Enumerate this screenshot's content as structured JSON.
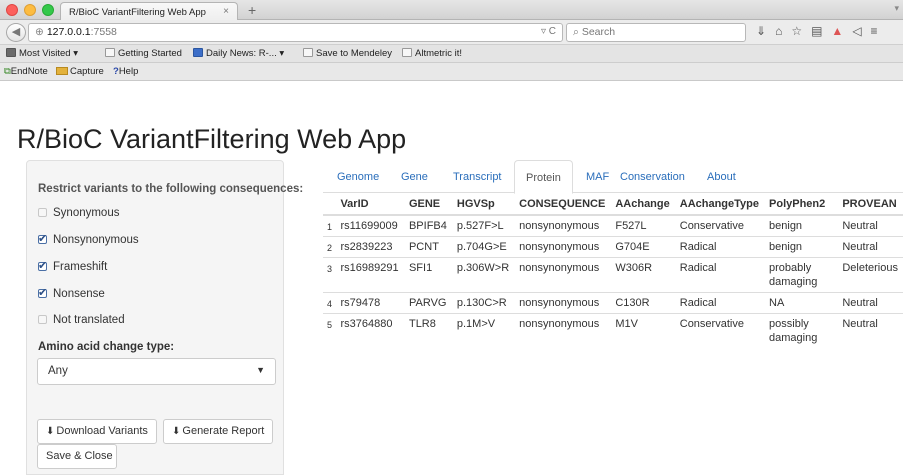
{
  "browser": {
    "tab_title": "R/BioC VariantFiltering Web App",
    "tab_close": "×",
    "new_tab": "+",
    "url_host": "127.0.0.1",
    "url_port": ":7558",
    "search_placeholder": "Search",
    "bookmarks": [
      "Most Visited ▾",
      "Getting Started",
      "Daily News: R-... ▾",
      "Save to Mendeley",
      "Altmetric it!"
    ],
    "addons": [
      "EndNote",
      "Capture",
      "Help"
    ]
  },
  "app": {
    "title": "R/BioC VariantFiltering Web App"
  },
  "sidebar": {
    "heading": "Restrict variants to the following consequences:",
    "consequences": [
      {
        "label": "Synonymous",
        "checked": false
      },
      {
        "label": "Nonsynonymous",
        "checked": true
      },
      {
        "label": "Frameshift",
        "checked": true
      },
      {
        "label": "Nonsense",
        "checked": true
      },
      {
        "label": "Not translated",
        "checked": false
      }
    ],
    "aa_label": "Amino acid change type:",
    "aa_value": "Any",
    "buttons": {
      "download": "Download Variants",
      "report": "Generate Report",
      "save_close": "Save & Close"
    }
  },
  "tabs": [
    "Genome",
    "Gene",
    "Transcript",
    "Protein",
    "MAF",
    "Conservation",
    "About"
  ],
  "active_tab": "Protein",
  "table": {
    "columns": [
      "",
      "VarID",
      "GENE",
      "HGVSp",
      "CONSEQUENCE",
      "AAchange",
      "AAchangeType",
      "PolyPhen2",
      "PROVEAN"
    ],
    "rows": [
      [
        "1",
        "rs11699009",
        "BPIFB4",
        "p.527F>L",
        "nonsynonymous",
        "F527L",
        "Conservative",
        "benign",
        "Neutral"
      ],
      [
        "2",
        "rs2839223",
        "PCNT",
        "p.704G>E",
        "nonsynonymous",
        "G704E",
        "Radical",
        "benign",
        "Neutral"
      ],
      [
        "3",
        "rs16989291",
        "SFI1",
        "p.306W>R",
        "nonsynonymous",
        "W306R",
        "Radical",
        "probably damaging",
        "Deleterious"
      ],
      [
        "4",
        "rs79478",
        "PARVG",
        "p.130C>R",
        "nonsynonymous",
        "C130R",
        "Radical",
        "NA",
        "Neutral"
      ],
      [
        "5",
        "rs3764880",
        "TLR8",
        "p.1M>V",
        "nonsynonymous",
        "M1V",
        "Conservative",
        "possibly damaging",
        "Neutral"
      ]
    ]
  }
}
